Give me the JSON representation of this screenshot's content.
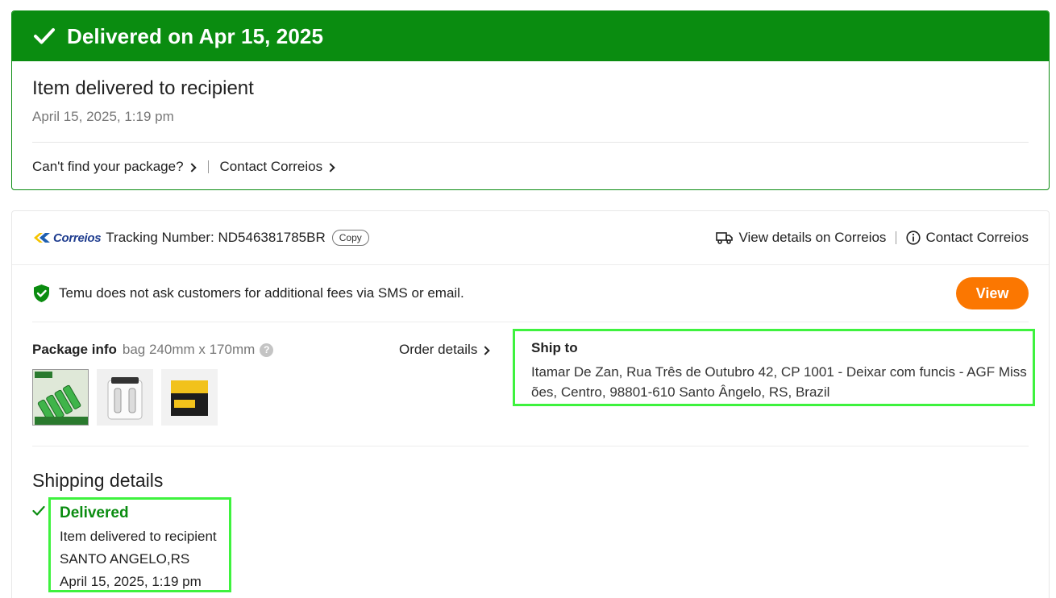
{
  "status": {
    "banner_title": "Delivered on Apr 15, 2025",
    "event_title": "Item delivered to recipient",
    "event_time": "April 15, 2025, 1:19 pm",
    "link_cant_find": "Can't find your package?",
    "link_contact": "Contact Correios",
    "accent_color": "#0a8c10"
  },
  "tracking": {
    "carrier_logo_text": "Correios",
    "label": "Tracking Number: ND546381785BR",
    "copy_label": "Copy",
    "view_details_label": "View details on Correios",
    "contact_label": "Contact Correios"
  },
  "notice": {
    "text": "Temu does not ask customers for additional fees via SMS or email.",
    "button_label": "View",
    "button_color": "#fb7701"
  },
  "package": {
    "label": "Package info",
    "value": "bag 240mm x 170mm",
    "help_glyph": "?",
    "order_details_label": "Order details",
    "thumbnails": [
      "battery-pack-product",
      "battery-charger-product",
      "memory-card-product"
    ]
  },
  "ship_to": {
    "label": "Ship to",
    "address": "Itamar De Zan,  Rua Três de Outubro 42, CP 1001 - Deixar com funcis - AGF Missões,  Centro, 98801-610 Santo Ângelo, RS, Brazil"
  },
  "shipping_details": {
    "heading": "Shipping details",
    "events": [
      {
        "status": "Delivered",
        "description": "Item delivered to recipient",
        "location": "SANTO ANGELO,RS",
        "time": "April 15, 2025, 1:19 pm"
      }
    ]
  }
}
